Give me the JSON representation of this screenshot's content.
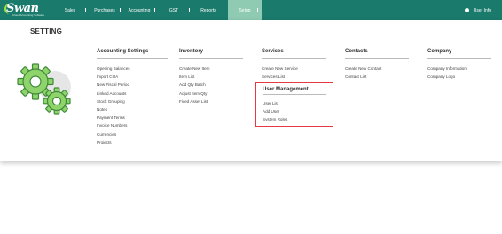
{
  "logo": {
    "word": "Swan",
    "tagline": "Cloud Accounting Software"
  },
  "nav": {
    "items": [
      {
        "label": "Sales"
      },
      {
        "label": "Purchases"
      },
      {
        "label": "Accounting"
      },
      {
        "label": "GST"
      },
      {
        "label": "Reports"
      },
      {
        "label": "Setup"
      }
    ],
    "user": "User Info"
  },
  "setting": {
    "title": "SETTING"
  },
  "columns": {
    "accounting": {
      "title": "Accounting Settings",
      "links": [
        "Opening Balances",
        "Import COA",
        "New Fiscal Period",
        "Linked Accounts",
        "Stock Grouping",
        "Notes",
        "Payment Terms",
        "Invoice Numbers",
        "Currencies",
        "Projects"
      ]
    },
    "inventory": {
      "title": "Inventory",
      "links": [
        "Create New Item",
        "Item List",
        "Add Qty Batch",
        "Adjust Item Qty",
        "Fixed Asset List"
      ]
    },
    "services": {
      "title": "Services",
      "links": [
        "Create New Service",
        "Services List"
      ]
    },
    "user_management": {
      "title": "User Management",
      "links": [
        "User List",
        "Add User",
        "System Roles"
      ]
    },
    "contacts": {
      "title": "Contacts",
      "links": [
        "Create New Contact",
        "Contact List"
      ]
    },
    "company": {
      "title": "Company",
      "links": [
        "Company Information",
        "Company Logo"
      ]
    }
  },
  "colors": {
    "nav_bg": "#1a7a6c",
    "active_tab": "#8fcab2",
    "gear_green": "#8fd46a",
    "highlight_border": "#e53946"
  }
}
